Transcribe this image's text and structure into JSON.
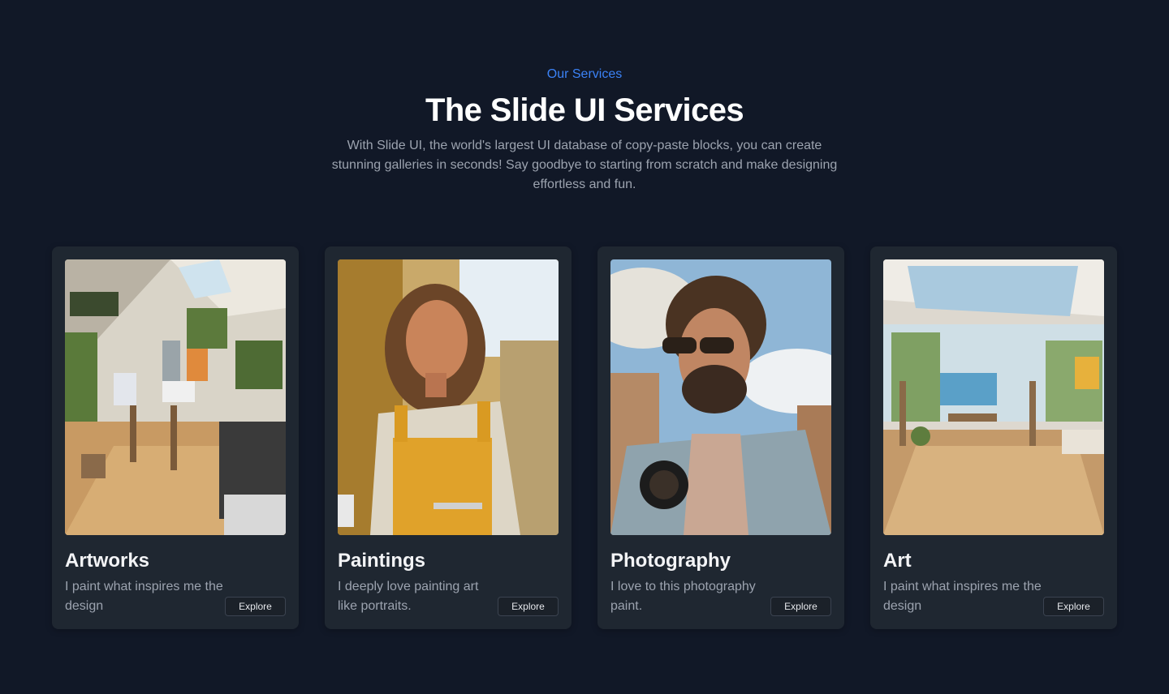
{
  "header": {
    "eyebrow": "Our Services",
    "title": "The Slide UI Services",
    "description": "With Slide UI, the world's largest UI database of copy-paste blocks, you can create stunning galleries in seconds! Say goodbye to starting from scratch and make designing effortless and fun."
  },
  "cards": [
    {
      "title": "Artworks",
      "text": "I paint what inspires me the design",
      "button": "Explore",
      "image": "sunlit art studio interior"
    },
    {
      "title": "Paintings",
      "text": "I deeply love painting art like portraits.",
      "button": "Explore",
      "image": "smiling woman in yellow overalls in a field"
    },
    {
      "title": "Photography",
      "text": "I love to this photography paint.",
      "button": "Explore",
      "image": "smiling man with sunglasses and camera"
    },
    {
      "title": "Art",
      "text": "I paint what inspires me the design",
      "button": "Explore",
      "image": "bright loft art studio with skylights"
    }
  ],
  "colors": {
    "background": "#111827",
    "card": "#1f2731",
    "accent": "#3b82f6"
  }
}
